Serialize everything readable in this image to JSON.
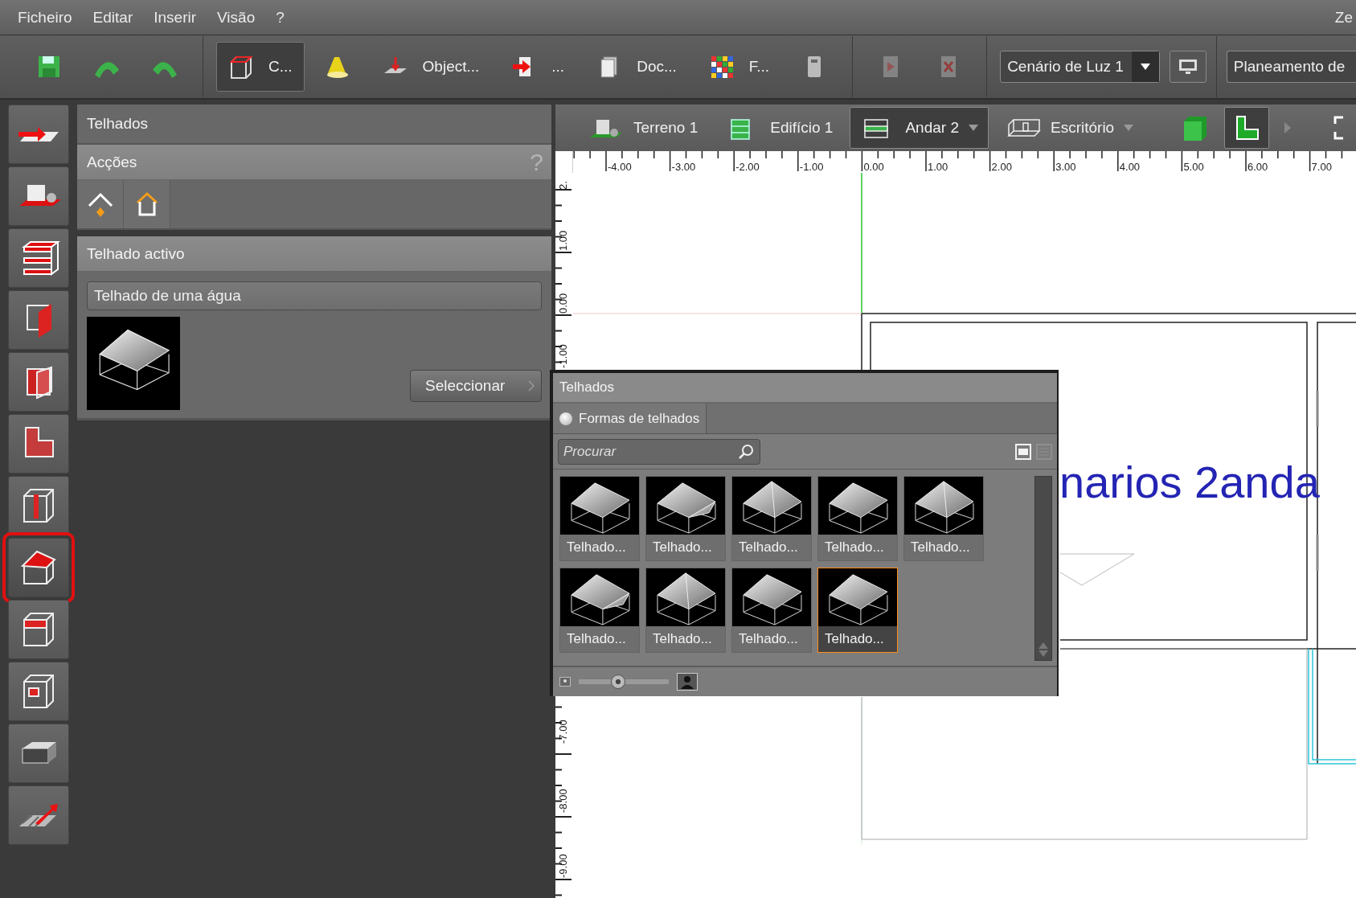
{
  "menu": {
    "items": [
      "Ficheiro",
      "Editar",
      "Inserir",
      "Visão",
      "?"
    ],
    "right_text": "Ze"
  },
  "toolbar": {
    "groups": [
      [
        {
          "kind": "icon",
          "selected": false,
          "disabled": false
        },
        {
          "kind": "icon",
          "selected": false,
          "disabled": false
        },
        {
          "kind": "icon",
          "selected": false,
          "disabled": false
        }
      ],
      [
        {
          "kind": "labeled",
          "label": "C...",
          "selected": true,
          "disabled": false
        },
        {
          "kind": "icon",
          "selected": false,
          "disabled": false
        },
        {
          "kind": "labeled",
          "label": "Object...",
          "selected": false,
          "disabled": false
        },
        {
          "kind": "labeled",
          "label": "...",
          "selected": false,
          "disabled": false
        },
        {
          "kind": "labeled",
          "label": "Doc...",
          "selected": false,
          "disabled": false
        },
        {
          "kind": "labeled",
          "label": "F...",
          "selected": false,
          "disabled": false
        },
        {
          "kind": "icon",
          "selected": false,
          "disabled": false
        }
      ],
      [
        {
          "kind": "icon",
          "selected": false,
          "disabled": true
        },
        {
          "kind": "icon",
          "selected": false,
          "disabled": true
        }
      ]
    ],
    "scene_dropdown": "Cenário de Luz 1",
    "mode_dropdown": "Planeamento de"
  },
  "sidebar": {
    "buttons": [
      {
        "selected": false
      },
      {
        "selected": false
      },
      {
        "selected": false
      },
      {
        "selected": false
      },
      {
        "selected": false
      },
      {
        "selected": false
      },
      {
        "selected": false
      },
      {
        "selected": true
      },
      {
        "selected": false
      },
      {
        "selected": false
      },
      {
        "selected": false
      },
      {
        "selected": false
      }
    ]
  },
  "left_panel": {
    "title": "Telhados",
    "actions": {
      "title": "Acções",
      "help": "?"
    },
    "active_roof": {
      "title": "Telhado activo",
      "value": "Telhado de uma água",
      "button": "Seleccionar"
    }
  },
  "view_tabs": [
    {
      "label": "Terreno 1",
      "selected": false,
      "dropdown": false
    },
    {
      "label": "Edifício 1",
      "selected": false,
      "dropdown": false
    },
    {
      "label": "Andar 2",
      "selected": true,
      "dropdown": true
    },
    {
      "label": "Escritório",
      "selected": false,
      "dropdown": true
    }
  ],
  "view_buttons": [
    {
      "selected": false
    },
    {
      "selected": true
    }
  ],
  "ruler": {
    "x_labels": [
      "-4.00",
      "-3.00",
      "-2.00",
      "-1.00",
      "0.00",
      "1.00",
      "2.00",
      "3.00",
      "4.00",
      "5.00",
      "6.00",
      "7.00"
    ],
    "y_labels": [
      "2.",
      "1.00",
      "0.00",
      "-1.00",
      "-7.00",
      "-8.00",
      "-9.00"
    ]
  },
  "canvas": {
    "plan_text": "narios 2anda"
  },
  "popup": {
    "title": "Telhados",
    "tab": "Formas de telhados",
    "search_placeholder": "Procurar",
    "view_modes": [
      {
        "selected": true
      },
      {
        "selected": false
      }
    ],
    "items": [
      {
        "label": "Telhado...",
        "selected": false
      },
      {
        "label": "Telhado...",
        "selected": false
      },
      {
        "label": "Telhado...",
        "selected": false
      },
      {
        "label": "Telhado...",
        "selected": false
      },
      {
        "label": "Telhado...",
        "selected": false
      },
      {
        "label": "Telhado...",
        "selected": false
      },
      {
        "label": "Telhado...",
        "selected": false
      },
      {
        "label": "Telhado...",
        "selected": false
      },
      {
        "label": "Telhado...",
        "selected": true
      }
    ],
    "zoom": {
      "level": 0.43
    }
  }
}
